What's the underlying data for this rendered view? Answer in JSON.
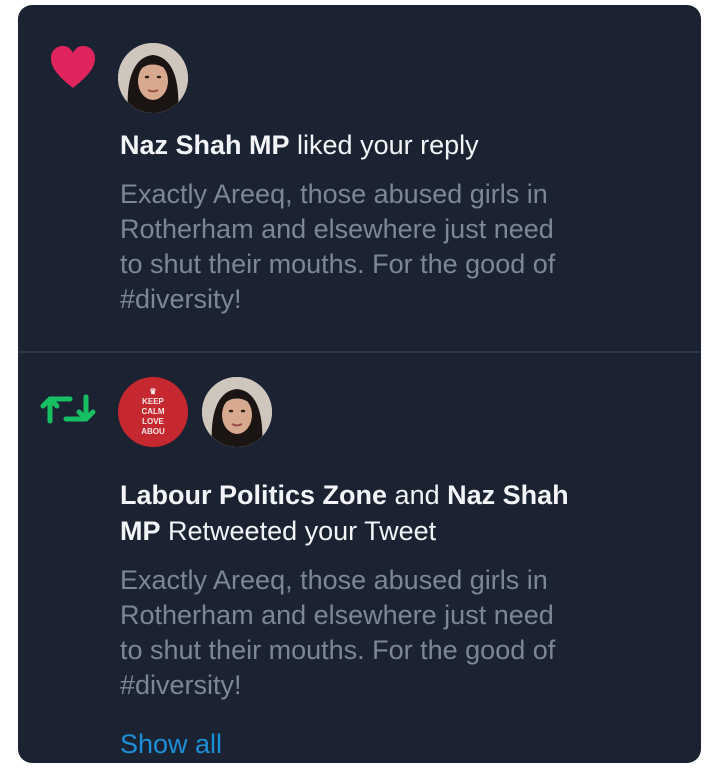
{
  "notifications": [
    {
      "type": "like",
      "icon": "heart-icon",
      "icon_color": "#e0245e",
      "actor": "Naz Shah MP",
      "action": "liked your reply",
      "tweet_text": "Exactly Areeq, those abused girls in\nRotherham and elsewhere just need\nto shut their mouths. For the good of\n#diversity!"
    },
    {
      "type": "retweet",
      "icon": "retweet-icon",
      "icon_color": "#17bf63",
      "avatar_keep_calm": [
        "KEEP",
        "CALM",
        "LOVE",
        "ABOU"
      ],
      "actor_1": "Labour Politics Zone",
      "connector": "and",
      "actor_2_line1": "Naz Shah",
      "actor_2_line2": "MP",
      "action": "Retweeted your Tweet",
      "tweet_text": "Exactly Areeq, those abused girls in\nRotherham and elsewhere just need\nto shut their mouths. For the good of\n#diversity!",
      "show_all": "Show all"
    }
  ],
  "colors": {
    "background": "#1b2332",
    "text_primary": "#f2f4f7",
    "text_secondary": "#7c8794",
    "link": "#1d8fd6"
  }
}
